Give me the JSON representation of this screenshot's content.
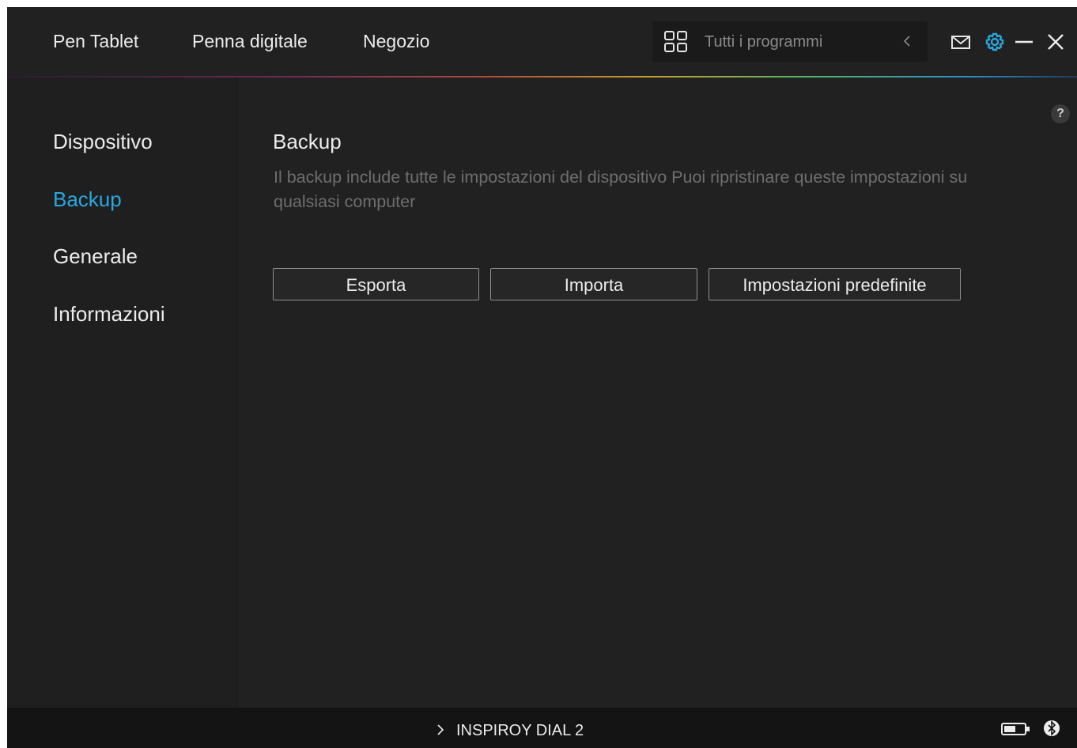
{
  "header": {
    "tabs": [
      {
        "label": "Pen Tablet"
      },
      {
        "label": "Penna digitale"
      },
      {
        "label": "Negozio"
      }
    ],
    "search": {
      "placeholder": "Tutti i programmi"
    },
    "icons": [
      "grid-icon",
      "chevron-left-icon",
      "mail-icon",
      "gear-icon",
      "minimize-icon",
      "close-icon"
    ],
    "accent_color": "#2aa7dd"
  },
  "sidebar": {
    "items": [
      {
        "label": "Dispositivo",
        "active": false
      },
      {
        "label": "Backup",
        "active": true
      },
      {
        "label": "Generale",
        "active": false
      },
      {
        "label": "Informazioni",
        "active": false
      }
    ]
  },
  "main": {
    "title": "Backup",
    "description": "Il backup include tutte le impostazioni del dispositivo Puoi ripristinare queste impostazioni su qualsiasi computer",
    "buttons": {
      "export": "Esporta",
      "import": "Importa",
      "defaults": "Impostazioni predefinite"
    },
    "help_label": "?"
  },
  "status": {
    "device_name": "INSPIROY DIAL 2",
    "icons": [
      "chevron-right-icon",
      "battery-icon",
      "bluetooth-icon"
    ]
  }
}
